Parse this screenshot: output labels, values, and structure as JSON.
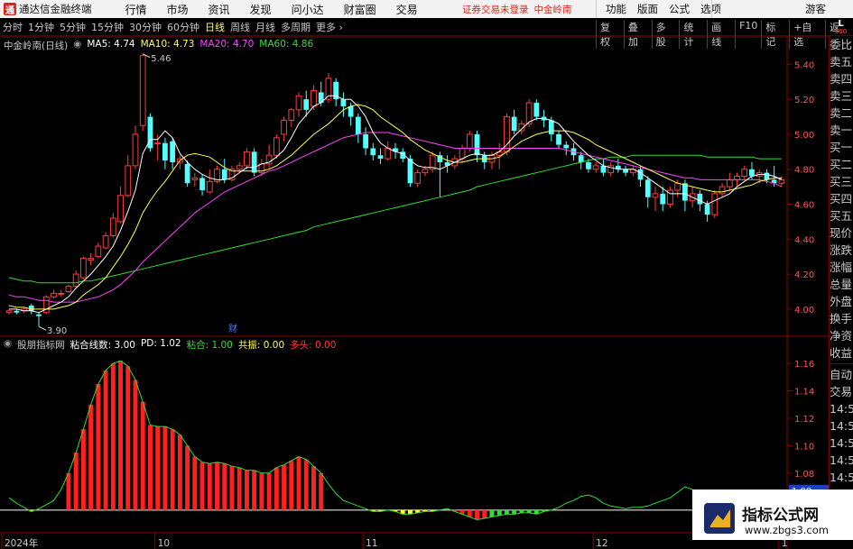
{
  "titlebar": {
    "logo": "通",
    "app_title": "通达信金融终端",
    "menu": [
      "行情",
      "市场",
      "资讯",
      "发现",
      "问小达",
      "财富圈",
      "交易"
    ],
    "notice": "证券交易未登录",
    "stock_name_red": "中金岭南",
    "right_menu": [
      "功能",
      "版面",
      "公式",
      "选项"
    ],
    "guest": "游客"
  },
  "toolbar": {
    "periods": [
      "分时",
      "1分钟",
      "5分钟",
      "15分钟",
      "30分钟",
      "60分钟",
      "日线",
      "周线",
      "月线",
      "多周期",
      "更多 ›"
    ],
    "active_period": "日线",
    "tools": [
      "复权",
      "叠加",
      "多股",
      "统计",
      "画线",
      "F10",
      "标记",
      "+自选",
      "返回"
    ]
  },
  "main_legend": {
    "stock": "中金岭南(日线)",
    "ma5": "MA5: 4.74",
    "ma10": "MA10: 4.73",
    "ma20": "MA20: 4.70",
    "ma60": "MA60: 4.86",
    "colors": {
      "ma5": "#ffffff",
      "ma10": "#ffff55",
      "ma20": "#ff44ff",
      "ma60": "#33dd33"
    }
  },
  "sub_legend": {
    "name": "股朋指标网",
    "line_count": "粘合线数: 3.00",
    "pd": "PD: 1.02",
    "nianhe": "粘合: 1.00",
    "gongzhen": "共振: 0.00",
    "duotou": "多头: 0.00"
  },
  "price_axis": [
    "5.40",
    "5.20",
    "5.00",
    "4.80",
    "4.60",
    "4.40",
    "4.20",
    "4.00"
  ],
  "sub_axis": [
    "1.16",
    "1.14",
    "1.12",
    "1.10",
    "1.08",
    "1.06"
  ],
  "sub_axis_highlight": "1.08",
  "annotations": {
    "high": "5.46",
    "low": "3.90",
    "event": "财"
  },
  "date_axis": [
    "2024年",
    "10",
    "11",
    "12",
    "1"
  ],
  "quote_labels": [
    "委比",
    "卖五",
    "卖四",
    "卖三",
    "卖二",
    "卖一",
    "买一",
    "买二",
    "买三",
    "买四",
    "买五",
    "现价",
    "涨跌",
    "涨幅",
    "总量",
    "外盘",
    "换手",
    "净资",
    "收益"
  ],
  "quote_right": [
    "自动",
    "交易",
    "14:56",
    "14:56",
    "14:56",
    "14:56",
    "14:56",
    "14:56",
    "14:56",
    "14:56"
  ],
  "lbox": {
    "l": "L",
    "s": "500"
  },
  "watermark": {
    "line1": "指标公式网",
    "line2": "www.zbgs3.com"
  },
  "colors": {
    "up": "#ff3b3b",
    "down": "#54ffff",
    "background": "#000000"
  },
  "chart_data": {
    "type": "candlestick",
    "candles": [
      [
        3.98,
        3.99,
        3.97,
        4.0
      ],
      [
        3.99,
        3.98,
        3.97,
        4.0
      ],
      [
        3.99,
        4.0,
        3.98,
        4.01
      ],
      [
        4.02,
        3.99,
        3.97,
        4.03
      ],
      [
        3.97,
        3.96,
        3.9,
        3.98
      ],
      [
        3.98,
        4.07,
        3.97,
        4.08
      ],
      [
        4.07,
        4.09,
        4.06,
        4.11
      ],
      [
        4.09,
        4.09,
        4.07,
        4.11
      ],
      [
        4.1,
        4.13,
        4.09,
        4.14
      ],
      [
        4.13,
        4.2,
        4.12,
        4.22
      ],
      [
        4.18,
        4.29,
        4.17,
        4.3
      ],
      [
        4.28,
        4.29,
        4.25,
        4.32
      ],
      [
        4.3,
        4.36,
        4.29,
        4.38
      ],
      [
        4.35,
        4.42,
        4.34,
        4.44
      ],
      [
        4.42,
        4.52,
        4.41,
        4.55
      ],
      [
        4.5,
        4.65,
        4.49,
        4.7
      ],
      [
        4.65,
        4.82,
        4.64,
        4.88
      ],
      [
        4.82,
        5.0,
        4.8,
        5.05
      ],
      [
        5.05,
        5.45,
        5.02,
        5.46
      ],
      [
        5.1,
        4.92,
        4.9,
        5.12
      ],
      [
        4.95,
        4.95,
        4.85,
        5.0
      ],
      [
        4.95,
        4.85,
        4.8,
        4.98
      ],
      [
        4.96,
        4.84,
        4.8,
        4.98
      ],
      [
        4.84,
        4.86,
        4.8,
        4.88
      ],
      [
        4.83,
        4.72,
        4.7,
        4.85
      ],
      [
        4.74,
        4.75,
        4.7,
        4.78
      ],
      [
        4.75,
        4.68,
        4.65,
        4.77
      ],
      [
        4.67,
        4.73,
        4.66,
        4.8
      ],
      [
        4.73,
        4.8,
        4.72,
        4.82
      ],
      [
        4.8,
        4.74,
        4.72,
        4.86
      ],
      [
        4.74,
        4.8,
        4.73,
        4.82
      ],
      [
        4.8,
        4.82,
        4.78,
        4.84
      ],
      [
        4.82,
        4.9,
        4.8,
        4.92
      ],
      [
        4.9,
        4.78,
        4.76,
        4.92
      ],
      [
        4.78,
        4.83,
        4.76,
        4.86
      ],
      [
        4.83,
        4.88,
        4.8,
        4.94
      ],
      [
        4.88,
        4.98,
        4.86,
        5.0
      ],
      [
        5.0,
        5.08,
        4.96,
        5.1
      ],
      [
        5.08,
        5.14,
        5.04,
        5.15
      ],
      [
        5.14,
        5.22,
        5.1,
        5.24
      ],
      [
        5.2,
        5.14,
        5.1,
        5.25
      ],
      [
        5.16,
        5.25,
        5.14,
        5.28
      ],
      [
        5.24,
        5.18,
        5.16,
        5.3
      ],
      [
        5.2,
        5.32,
        5.18,
        5.35
      ],
      [
        5.3,
        5.2,
        5.16,
        5.32
      ],
      [
        5.2,
        5.16,
        5.1,
        5.24
      ],
      [
        5.16,
        5.1,
        5.05,
        5.18
      ],
      [
        5.1,
        5.0,
        4.95,
        5.12
      ],
      [
        5.0,
        4.92,
        4.88,
        5.04
      ],
      [
        4.92,
        4.88,
        4.85,
        4.95
      ],
      [
        4.88,
        4.86,
        4.83,
        4.92
      ],
      [
        4.86,
        4.92,
        4.85,
        4.96
      ],
      [
        4.92,
        4.9,
        4.86,
        4.95
      ],
      [
        4.9,
        4.86,
        4.84,
        4.92
      ],
      [
        4.86,
        4.72,
        4.7,
        4.88
      ],
      [
        4.72,
        4.78,
        4.7,
        4.8
      ],
      [
        4.78,
        4.8,
        4.76,
        4.82
      ],
      [
        4.8,
        4.88,
        4.78,
        4.9
      ],
      [
        4.88,
        4.84,
        4.64,
        4.9
      ],
      [
        4.84,
        4.82,
        4.78,
        4.88
      ],
      [
        4.82,
        4.86,
        4.8,
        4.88
      ],
      [
        4.86,
        4.92,
        4.84,
        4.94
      ],
      [
        4.92,
        5.0,
        4.9,
        5.02
      ],
      [
        5.0,
        4.88,
        4.84,
        5.02
      ],
      [
        4.88,
        4.84,
        4.8,
        4.9
      ],
      [
        4.84,
        4.88,
        4.8,
        4.9
      ],
      [
        4.88,
        4.9,
        4.8,
        4.95
      ],
      [
        4.9,
        5.1,
        4.88,
        5.12
      ],
      [
        5.1,
        5.02,
        5.0,
        5.14
      ],
      [
        5.02,
        5.06,
        5.0,
        5.08
      ],
      [
        5.06,
        5.18,
        5.04,
        5.2
      ],
      [
        5.18,
        5.1,
        5.08,
        5.2
      ],
      [
        5.1,
        5.08,
        5.04,
        5.14
      ],
      [
        5.08,
        5.0,
        4.96,
        5.1
      ],
      [
        5.0,
        4.94,
        4.92,
        5.02
      ],
      [
        4.94,
        4.92,
        4.88,
        4.96
      ],
      [
        4.92,
        4.88,
        4.85,
        4.95
      ],
      [
        4.88,
        4.84,
        4.8,
        4.9
      ],
      [
        4.84,
        4.8,
        4.78,
        4.86
      ],
      [
        4.8,
        4.82,
        4.78,
        4.84
      ],
      [
        4.82,
        4.78,
        4.76,
        4.86
      ],
      [
        4.78,
        4.82,
        4.76,
        4.84
      ],
      [
        4.82,
        4.8,
        4.78,
        4.86
      ],
      [
        4.8,
        4.78,
        4.76,
        4.82
      ],
      [
        4.78,
        4.8,
        4.76,
        4.82
      ],
      [
        4.8,
        4.74,
        4.7,
        4.82
      ],
      [
        4.74,
        4.64,
        4.58,
        4.76
      ],
      [
        4.64,
        4.66,
        4.56,
        4.7
      ],
      [
        4.66,
        4.6,
        4.56,
        4.7
      ],
      [
        4.6,
        4.68,
        4.58,
        4.7
      ],
      [
        4.68,
        4.72,
        4.64,
        4.74
      ],
      [
        4.72,
        4.62,
        4.56,
        4.74
      ],
      [
        4.62,
        4.66,
        4.58,
        4.7
      ],
      [
        4.66,
        4.6,
        4.56,
        4.68
      ],
      [
        4.6,
        4.54,
        4.5,
        4.62
      ],
      [
        4.54,
        4.66,
        4.52,
        4.68
      ],
      [
        4.66,
        4.7,
        4.64,
        4.72
      ],
      [
        4.7,
        4.74,
        4.68,
        4.78
      ],
      [
        4.74,
        4.76,
        4.7,
        4.78
      ],
      [
        4.76,
        4.8,
        4.74,
        4.82
      ],
      [
        4.8,
        4.76,
        4.74,
        4.84
      ],
      [
        4.76,
        4.78,
        4.72,
        4.8
      ],
      [
        4.78,
        4.74,
        4.72,
        4.8
      ],
      [
        4.74,
        4.72,
        4.7,
        4.82
      ],
      [
        4.72,
        4.74,
        4.7,
        4.76
      ]
    ],
    "ma5": [
      4.0,
      4.0,
      3.99,
      3.99,
      3.98,
      4.0,
      4.02,
      4.04,
      4.07,
      4.12,
      4.16,
      4.2,
      4.25,
      4.3,
      4.36,
      4.45,
      4.56,
      4.68,
      4.89,
      4.97,
      4.97,
      5.02,
      4.98,
      4.89,
      4.84,
      4.8,
      4.77,
      4.75,
      4.74,
      4.74,
      4.75,
      4.78,
      4.81,
      4.81,
      4.83,
      4.84,
      4.87,
      4.91,
      4.98,
      5.06,
      5.11,
      5.16,
      5.18,
      5.22,
      5.22,
      5.2,
      5.2,
      5.16,
      5.1,
      5.01,
      4.95,
      4.92,
      4.9,
      4.89,
      4.85,
      4.82,
      4.81,
      4.81,
      4.8,
      4.82,
      4.84,
      4.86,
      4.88,
      4.89,
      4.88,
      4.88,
      4.9,
      4.94,
      4.99,
      5.03,
      5.07,
      5.09,
      5.09,
      5.08,
      5.06,
      5.01,
      4.96,
      4.92,
      4.88,
      4.85,
      4.82,
      4.81,
      4.8,
      4.8,
      4.8,
      4.78,
      4.75,
      4.72,
      4.69,
      4.66,
      4.66,
      4.66,
      4.64,
      4.62,
      4.6,
      4.62,
      4.64,
      4.66,
      4.7,
      4.73,
      4.76,
      4.77,
      4.77,
      4.76,
      4.74
    ],
    "ma10": [
      4.02,
      4.01,
      4.01,
      4.0,
      4.0,
      4.0,
      4.0,
      4.01,
      4.02,
      4.04,
      4.08,
      4.11,
      4.14,
      4.18,
      4.24,
      4.3,
      4.37,
      4.45,
      4.55,
      4.62,
      4.68,
      4.73,
      4.79,
      4.85,
      4.88,
      4.89,
      4.88,
      4.87,
      4.84,
      4.81,
      4.79,
      4.79,
      4.79,
      4.79,
      4.79,
      4.8,
      4.82,
      4.85,
      4.88,
      4.92,
      4.96,
      5.0,
      5.03,
      5.06,
      5.1,
      5.14,
      5.16,
      5.17,
      5.16,
      5.14,
      5.1,
      5.07,
      5.04,
      5.01,
      4.97,
      4.94,
      4.91,
      4.89,
      4.87,
      4.85,
      4.84,
      4.84,
      4.85,
      4.86,
      4.86,
      4.86,
      4.87,
      4.9,
      4.93,
      4.96,
      4.98,
      5.0,
      5.01,
      5.02,
      5.02,
      5.02,
      5.01,
      4.99,
      4.97,
      4.94,
      4.92,
      4.9,
      4.88,
      4.86,
      4.84,
      4.82,
      4.8,
      4.78,
      4.76,
      4.74,
      4.72,
      4.71,
      4.7,
      4.69,
      4.68,
      4.67,
      4.67,
      4.68,
      4.69,
      4.7,
      4.71,
      4.73,
      4.74,
      4.75,
      4.75
    ],
    "ma20": [
      4.08,
      4.07,
      4.07,
      4.06,
      4.05,
      4.05,
      4.04,
      4.04,
      4.04,
      4.04,
      4.05,
      4.06,
      4.07,
      4.09,
      4.11,
      4.14,
      4.18,
      4.22,
      4.27,
      4.31,
      4.35,
      4.39,
      4.43,
      4.47,
      4.51,
      4.55,
      4.58,
      4.61,
      4.64,
      4.67,
      4.69,
      4.71,
      4.73,
      4.75,
      4.77,
      4.79,
      4.8,
      4.82,
      4.84,
      4.86,
      4.88,
      4.9,
      4.92,
      4.94,
      4.96,
      4.98,
      4.99,
      5.0,
      5.01,
      5.01,
      5.01,
      5.01,
      5.0,
      4.99,
      4.98,
      4.97,
      4.96,
      4.95,
      4.94,
      4.93,
      4.92,
      4.92,
      4.92,
      4.92,
      4.92,
      4.92,
      4.92,
      4.92,
      4.92,
      4.92,
      4.92,
      4.92,
      4.92,
      4.92,
      4.92,
      4.91,
      4.9,
      4.89,
      4.88,
      4.87,
      4.86,
      4.85,
      4.84,
      4.83,
      4.82,
      4.81,
      4.8,
      4.79,
      4.78,
      4.77,
      4.76,
      4.75,
      4.75,
      4.74,
      4.74,
      4.74,
      4.74,
      4.74,
      4.74,
      4.74,
      4.74,
      4.74,
      4.73,
      4.72,
      4.7
    ],
    "ma60": [
      4.18,
      4.17,
      4.16,
      4.16,
      4.15,
      4.15,
      4.15,
      4.15,
      4.15,
      4.15,
      4.16,
      4.16,
      4.17,
      4.18,
      4.19,
      4.2,
      4.21,
      4.22,
      4.23,
      4.24,
      4.25,
      4.26,
      4.27,
      4.28,
      4.29,
      4.3,
      4.31,
      4.32,
      4.33,
      4.34,
      4.35,
      4.36,
      4.37,
      4.38,
      4.39,
      4.4,
      4.41,
      4.42,
      4.43,
      4.44,
      4.45,
      4.47,
      4.48,
      4.49,
      4.5,
      4.51,
      4.52,
      4.53,
      4.54,
      4.55,
      4.56,
      4.57,
      4.58,
      4.59,
      4.6,
      4.61,
      4.62,
      4.63,
      4.64,
      4.65,
      4.66,
      4.67,
      4.68,
      4.7,
      4.71,
      4.72,
      4.73,
      4.74,
      4.75,
      4.76,
      4.77,
      4.78,
      4.79,
      4.8,
      4.81,
      4.82,
      4.83,
      4.84,
      4.85,
      4.86,
      4.86,
      4.87,
      4.87,
      4.87,
      4.88,
      4.88,
      4.88,
      4.88,
      4.88,
      4.88,
      4.88,
      4.88,
      4.88,
      4.88,
      4.87,
      4.87,
      4.87,
      4.87,
      4.87,
      4.87,
      4.87,
      4.86,
      4.86,
      4.86,
      4.86
    ],
    "sub_series": [
      1.062,
      1.058,
      1.055,
      1.052,
      1.054,
      1.057,
      1.06,
      1.068,
      1.08,
      1.095,
      1.112,
      1.13,
      1.145,
      1.155,
      1.16,
      1.162,
      1.158,
      1.148,
      1.132,
      1.115,
      1.114,
      1.114,
      1.112,
      1.108,
      1.1,
      1.092,
      1.088,
      1.087,
      1.088,
      1.087,
      1.085,
      1.084,
      1.082,
      1.082,
      1.08,
      1.08,
      1.084,
      1.086,
      1.089,
      1.092,
      1.09,
      1.085,
      1.08,
      1.072,
      1.065,
      1.06,
      1.058,
      1.056,
      1.054,
      1.052,
      1.052,
      1.053,
      1.052,
      1.05,
      1.05,
      1.051,
      1.052,
      1.052,
      1.053,
      1.054,
      1.052,
      1.05,
      1.048,
      1.046,
      1.047,
      1.048,
      1.049,
      1.05,
      1.05,
      1.051,
      1.051,
      1.05,
      1.052,
      1.053,
      1.055,
      1.058,
      1.06,
      1.063,
      1.064,
      1.062,
      1.058,
      1.056,
      1.055,
      1.054,
      1.055,
      1.055,
      1.056,
      1.058,
      1.06,
      1.062,
      1.066,
      1.07,
      1.068,
      1.066,
      1.064,
      1.062,
      1.061,
      1.06,
      1.06,
      1.06,
      1.06,
      1.06,
      1.06,
      1.06,
      1.06
    ],
    "sub_baseline": 1.053,
    "sub_ylim": [
      1.045,
      1.17
    ],
    "price_ylim": [
      3.86,
      5.5
    ]
  }
}
